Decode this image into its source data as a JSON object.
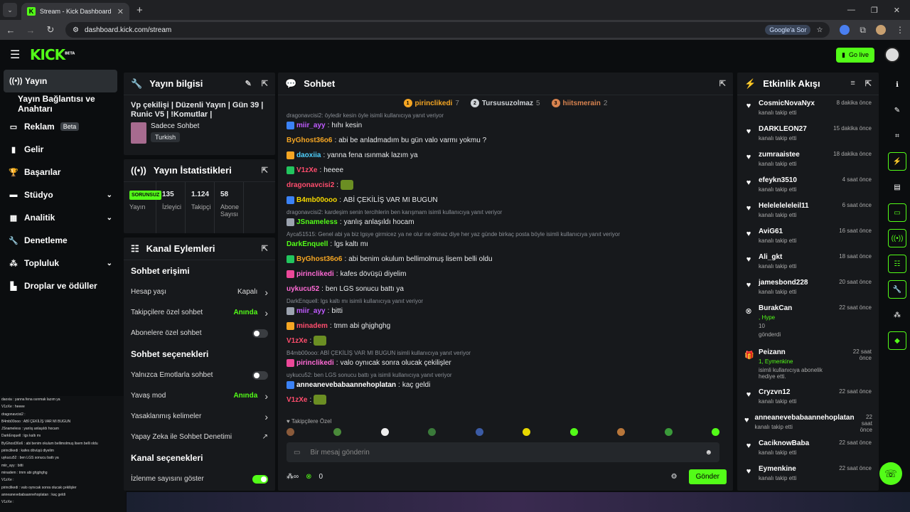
{
  "browser": {
    "tab_title": "Stream - Kick Dashboard",
    "url": "dashboard.kick.com/stream",
    "google_btn": "Google'a Sor"
  },
  "header": {
    "logo": "KICK",
    "logo_badge": "BETA",
    "go_live": "Go live"
  },
  "sidebar": {
    "items": [
      {
        "label": "Yayın",
        "icon": "stream-icon",
        "active": true
      },
      {
        "label": "Yayın Bağlantısı ve Anahtarı",
        "icon": ""
      },
      {
        "label": "Reklam",
        "icon": "ad-icon",
        "badge": "Beta"
      },
      {
        "label": "Gelir",
        "icon": "chart-icon"
      },
      {
        "label": "Başarılar",
        "icon": "trophy-icon"
      },
      {
        "label": "Stüdyo",
        "icon": "studio-icon",
        "chevron": true
      },
      {
        "label": "Analitik",
        "icon": "analytics-icon",
        "chevron": true
      },
      {
        "label": "Denetleme",
        "icon": "wrench-icon"
      },
      {
        "label": "Topluluk",
        "icon": "community-icon",
        "chevron": true
      },
      {
        "label": "Droplar ve ödüller",
        "icon": "drops-icon"
      }
    ]
  },
  "mini_chat": [
    "daoxia : yanna fena ısınmak lazım ya",
    "V1zXe : heeee",
    "dragonavcisi2 :",
    "B4mb00ooo : ABİ ÇEKİLİŞ VAR MI BUGUN",
    "JSnameless : yanlış anlaşıldı hocam",
    "DarkEnquell : lgs kaltı mı",
    "ByGhost36o6 : abi benim okulum bellimolmuş lisem belli oldu",
    "pirinclikedi : kafes dövüşü diyelim",
    "uykucu52 : ben LGS sonucu battı ya",
    "miir_ayy : bitti",
    "minadem : tmm abi ghjghghg",
    "V1zXe :",
    "pirinclikedi : valo oynıcak sonra olucak çekilişler",
    "anneanevebabaannehoplatan : kaç geldi",
    "V1zXe :"
  ],
  "stream_info": {
    "title": "Yayın bilgisi",
    "stream_title": "Vp çekilişi | Düzenli Yayın | Gün 39 | Runic V5 | !Komutlar |",
    "category": "Sadece Sohbet",
    "tag": "Turkish"
  },
  "stream_stats": {
    "title": "Yayın İstatistikleri",
    "stats": [
      {
        "value": "SORUNSUZ",
        "label": "Yayın"
      },
      {
        "value": "135",
        "label": "İzleyici"
      },
      {
        "value": "1.124",
        "label": "Takipçi"
      },
      {
        "value": "58",
        "label": "Abone Sayısı"
      }
    ]
  },
  "channel_actions": {
    "title": "Kanal Eylemleri",
    "sections": [
      {
        "heading": "Sohbet erişimi",
        "options": [
          {
            "label": "Hesap yaşı",
            "value": "Kapalı",
            "type": "link"
          },
          {
            "label": "Takipçilere özel sohbet",
            "value": "Anında",
            "type": "link-green"
          },
          {
            "label": "Abonelere özel sohbet",
            "type": "toggle"
          }
        ]
      },
      {
        "heading": "Sohbet seçenekleri",
        "options": [
          {
            "label": "Yalnızca Emotlarla sohbet",
            "type": "toggle"
          },
          {
            "label": "Yavaş mod",
            "value": "Anında",
            "type": "link-green"
          },
          {
            "label": "Yasaklanmış kelimeler",
            "type": "link"
          },
          {
            "label": "Yapay Zeka ile Sohbet Denetimi",
            "type": "external"
          }
        ]
      },
      {
        "heading": "Kanal seçenekleri",
        "options": [
          {
            "label": "İzlenme sayısını göster",
            "type": "toggle-on"
          }
        ]
      }
    ]
  },
  "chat": {
    "title": "Sohbet",
    "pinned": [
      {
        "rank": "1",
        "name": "pirinclikedi",
        "count": "7",
        "color": "#f5a623"
      },
      {
        "rank": "2",
        "name": "Tursusuzolmaz",
        "count": "5",
        "color": "#d0d4d8"
      },
      {
        "rank": "3",
        "name": "hiitsmerain",
        "count": "2",
        "color": "#d8834f"
      }
    ],
    "messages": [
      {
        "reply": "dragonavcisi2: öyledir kesin öyle isimli kullanıcıya yanıt veriyor",
        "user": "miir_ayy",
        "color": "#c05bff",
        "text": "hıhı kesin"
      },
      {
        "user": "ByGhost36o6",
        "color": "#f5a623",
        "text": "abi be anladmadım bu gün valo varmı yokmu ?"
      },
      {
        "user": "daoxiia",
        "color": "#4fd1ff",
        "text": "yanna fena ısınmak lazım ya"
      },
      {
        "user": "V1zXe",
        "color": "#ff4d6d",
        "text": "heeee"
      },
      {
        "user": "dragonavcisi2",
        "color": "#ff4d6d",
        "text": ""
      },
      {
        "user": "B4mb00ooo",
        "color": "#f5d800",
        "text": "ABİ ÇEKİLİŞ VAR MI BUGUN"
      },
      {
        "reply": "dragonavcisi2: kardeşim senin tercihlerin ben karışmam isimli kullanıcıya yanıt veriyor",
        "user": "JSnameless",
        "color": "#53fc18",
        "text": "yanlış anlaşıldı hocam"
      },
      {
        "reply": "Ayca51515: Genel abi ya biz lgsye girmicez ya ne olur ne olmaz diye her yaz günde birkaç posta böyle isimli kullanıcıya yanıt veriyor",
        "user": "DarkEnquell",
        "color": "#53fc18",
        "text": "lgs kaltı mı"
      },
      {
        "user": "ByGhost36o6",
        "color": "#f5a623",
        "text": "abi benim okulum bellimolmuş lisem belli oldu"
      },
      {
        "user": "pirinclikedi",
        "color": "#ff6ad5",
        "text": "kafes dövüşü diyelim"
      },
      {
        "user": "uykucu52",
        "color": "#ff6ad5",
        "text": "ben LGS sonucu battı ya"
      },
      {
        "reply": "DarkEnquell: lgs kaltı mı isimli kullanıcıya yanıt veriyor",
        "user": "miir_ayy",
        "color": "#c05bff",
        "text": "bitti"
      },
      {
        "user": "minadem",
        "color": "#ff4d6d",
        "text": "tmm abi ghjghghg"
      },
      {
        "user": "V1zXe",
        "color": "#ff4d6d",
        "text": ""
      },
      {
        "reply": "B4mb00ooo: ABİ ÇEKİLİŞ VAR MI BUGUN isimli kullanıcıya yanıt veriyor",
        "user": "pirinclikedi",
        "color": "#ff6ad5",
        "text": "valo oynıcak sonra olucak çekilişler"
      },
      {
        "reply": "uykucu52: ben LGS sonucu battı ya isimli kullanıcıya yanıt veriyor",
        "user": "anneanevebabaannehoplatan",
        "color": "#ffffff",
        "text": "kaç geldi"
      },
      {
        "user": "V1zXe",
        "color": "#ff4d6d",
        "text": ""
      }
    ],
    "emote_label": "Takipçilere Özel",
    "input_placeholder": "Bir mesaj gönderin",
    "points": "0",
    "send": "Gönder"
  },
  "events": {
    "title": "Etkinlik Akışı",
    "items": [
      {
        "name": "CosmicNovaNyx",
        "desc": "kanalı takip etti",
        "time": "8 dakika önce"
      },
      {
        "name": "DARKLEON27",
        "desc": "kanalı takip etti",
        "time": "15 dakika önce"
      },
      {
        "name": "zumraaistee",
        "desc": "kanalı takip etti",
        "time": "18 dakika önce"
      },
      {
        "name": "efeykn3510",
        "desc": "kanalı takip etti",
        "time": "4 saat önce"
      },
      {
        "name": "Heleleleleleil11",
        "desc": "kanalı takip etti",
        "time": "6 saat önce"
      },
      {
        "name": "AviG61",
        "desc": "kanalı takip etti",
        "time": "16 saat önce"
      },
      {
        "name": "Ali_gkt",
        "desc": "kanalı takip etti",
        "time": "18 saat önce"
      },
      {
        "name": "jamesbond228",
        "desc": "kanalı takip etti",
        "time": "20 saat önce"
      },
      {
        "name": "BurakCan",
        "desc": ", Hype",
        "desc2": "10",
        "desc3": "gönderdi",
        "time": "22 saat önce",
        "type": "kick"
      },
      {
        "name": "Peizann",
        "desc": "1, Eymenkine",
        "desc2": "isimli kullanıcıya abonelik hediye etti.",
        "time": "22 saat önce",
        "type": "gift"
      },
      {
        "name": "Cryzvn12",
        "desc": "kanalı takip etti",
        "time": "22 saat önce"
      },
      {
        "name": "anneanevebabaannehoplatan",
        "desc": "kanalı takip etti",
        "time": "22 saat önce"
      },
      {
        "name": "CaciknowBaba",
        "desc": "kanalı takip etti",
        "time": "22 saat önce"
      },
      {
        "name": "Eymenkine",
        "desc": "kanalı takip etti",
        "time": "22 saat önce"
      }
    ]
  }
}
